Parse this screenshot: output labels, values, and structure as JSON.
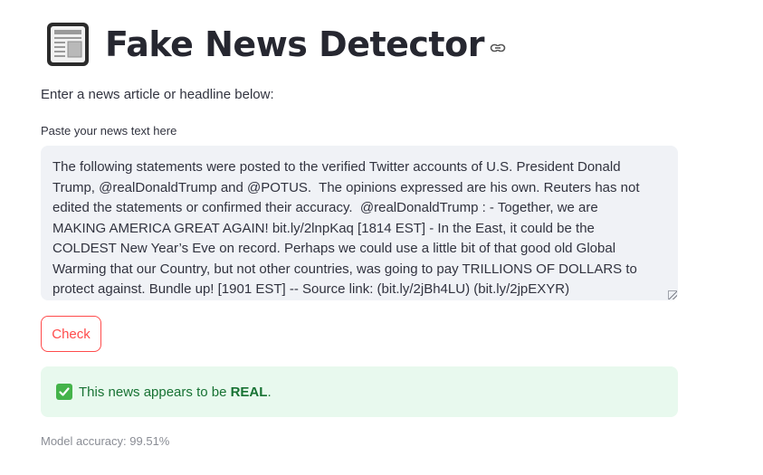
{
  "header": {
    "icon": "newspaper-icon",
    "title": "Fake News Detector",
    "anchor_icon": "link-icon"
  },
  "intro_text": "Enter a news article or headline below:",
  "input": {
    "label": "Paste your news text here",
    "value": "The following statements were posted to the verified Twitter accounts of U.S. President Donald Trump, @realDonaldTrump and @POTUS.  The opinions expressed are his own. Reuters has not edited the statements or confirmed their accuracy.  @realDonaldTrump : - Together, we are MAKING AMERICA GREAT AGAIN! bit.ly/2lnpKaq [1814 EST] - In the East, it could be the COLDEST New Year’s Eve on record. Perhaps we could use a little bit of that good old Global Warming that our Country, but not other countries, was going to pay TRILLIONS OF DOLLARS to protect against. Bundle up! [1901 EST] -- Source link: (bit.ly/2jBh4LU) (bit.ly/2jpEXYR)"
  },
  "check_button": {
    "label": "Check"
  },
  "result": {
    "icon": "check-mark-icon",
    "prefix": "This news appears to be ",
    "verdict": "REAL",
    "suffix": "."
  },
  "accuracy_text": "Model accuracy: 99.51%",
  "colors": {
    "accent": "#ff4b4b",
    "success_bg": "#e8f9ee",
    "success_text": "#177233",
    "input_bg": "#f0f2f6"
  }
}
